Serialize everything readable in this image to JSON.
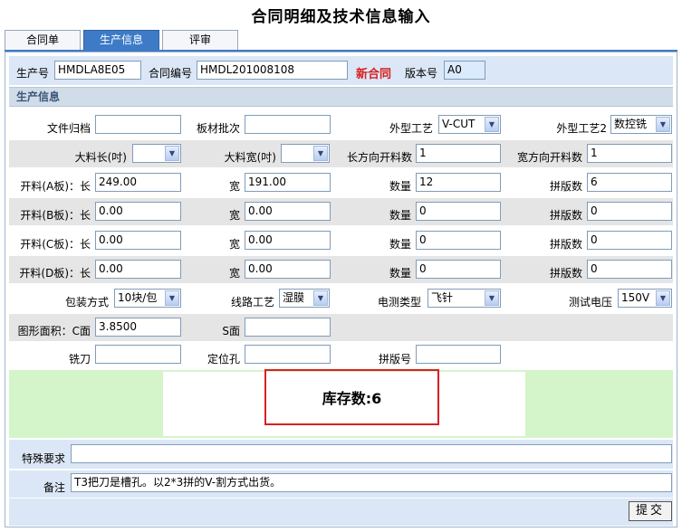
{
  "page": {
    "title": "合同明细及技术信息输入"
  },
  "tabs": [
    {
      "label": "合同单"
    },
    {
      "label": "生产信息"
    },
    {
      "label": "评审"
    }
  ],
  "header": {
    "prod_no_label": "生产号",
    "prod_no": "HMDLA8E05",
    "contract_no_label": "合同编号",
    "contract_no": "HMDL201008108",
    "new_contract": "新合同",
    "version_label": "版本号",
    "version": "A0"
  },
  "section": {
    "title": "生产信息"
  },
  "row1": {
    "file_label": "文件归档",
    "file": "",
    "batch_label": "板材批次",
    "batch": "",
    "shape_label": "外型工艺",
    "shape": "V-CUT",
    "shape2_label": "外型工艺2",
    "shape2": "数控铣"
  },
  "row2": {
    "long_label": "大料长(吋)",
    "long": "",
    "wide_label": "大料宽(吋)",
    "wide": "",
    "long_cut_label": "长方向开料数",
    "long_cut": "1",
    "wide_cut_label": "宽方向开料数",
    "wide_cut": "1"
  },
  "boards": [
    {
      "label": "开料(A板)：长",
      "length": "249.00",
      "width_label": "宽",
      "width": "191.00",
      "qty_label": "数量",
      "qty": "12",
      "panel_label": "拼版数",
      "panel": "6"
    },
    {
      "label": "开料(B板)：长",
      "length": "0.00",
      "width_label": "宽",
      "width": "0.00",
      "qty_label": "数量",
      "qty": "0",
      "panel_label": "拼版数",
      "panel": "0"
    },
    {
      "label": "开料(C板)：长",
      "length": "0.00",
      "width_label": "宽",
      "width": "0.00",
      "qty_label": "数量",
      "qty": "0",
      "panel_label": "拼版数",
      "panel": "0"
    },
    {
      "label": "开料(D板)：长",
      "length": "0.00",
      "width_label": "宽",
      "width": "0.00",
      "qty_label": "数量",
      "qty": "0",
      "panel_label": "拼版数",
      "panel": "0"
    }
  ],
  "row7": {
    "pack_label": "包装方式",
    "pack": "10块/包",
    "circuit_label": "线路工艺",
    "circuit": "湿膜",
    "test_label": "电测类型",
    "test": "飞针",
    "voltage_label": "测试电压",
    "voltage": "150V"
  },
  "row8": {
    "area_c_label": "图形面积：C面",
    "area_c": "3.8500",
    "area_s_label": "S面",
    "area_s": ""
  },
  "row9": {
    "mill_label": "铣刀",
    "mill": "",
    "locate_label": "定位孔",
    "locate": "",
    "panel_no_label": "拼版号",
    "panel_no": ""
  },
  "stock": {
    "text": "库存数:6"
  },
  "special": {
    "label": "特殊要求",
    "value": ""
  },
  "remark": {
    "label": "备注",
    "value": "T3把刀是槽孔。以2*3拼的V-割方式出货。"
  },
  "submit": {
    "label": "提交"
  },
  "colors": {
    "accent": "#3e7bc6",
    "alert": "#d92020",
    "stock_bg": "#d4f5c9"
  }
}
